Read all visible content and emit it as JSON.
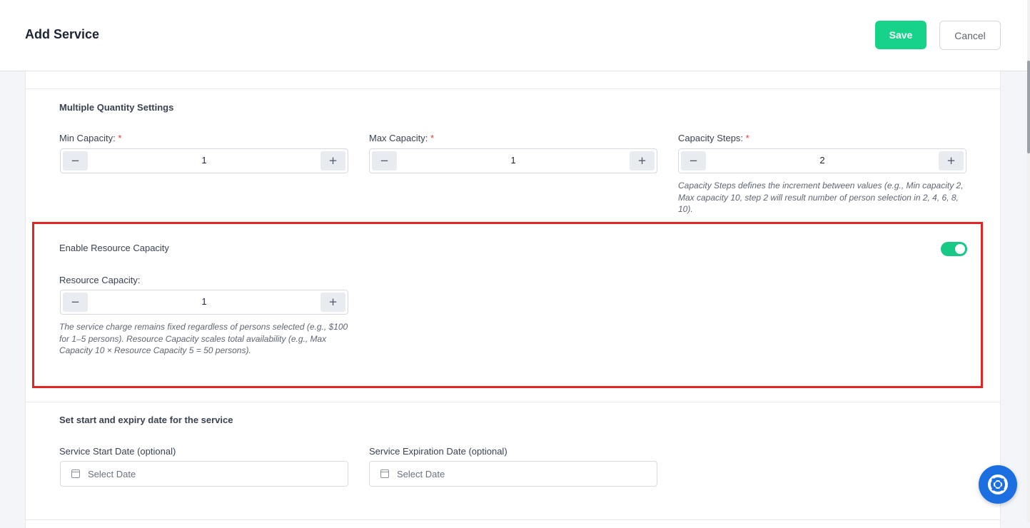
{
  "header": {
    "title": "Add Service",
    "save_label": "Save",
    "cancel_label": "Cancel"
  },
  "quantity": {
    "title": "Multiple Quantity Settings",
    "min": {
      "label": "Min Capacity:",
      "required": "*",
      "value": "1",
      "minus": "−",
      "plus": "+"
    },
    "max": {
      "label": "Max Capacity:",
      "required": "*",
      "value": "1",
      "minus": "−",
      "plus": "+"
    },
    "steps": {
      "label": "Capacity Steps:",
      "required": "*",
      "value": "2",
      "minus": "−",
      "plus": "+"
    },
    "steps_hint": "Capacity Steps defines the increment between values (e.g., Min capacity 2, Max capacity 10, step 2 will result number of person selection in 2, 4, 6, 8, 10)."
  },
  "resource": {
    "title": "Enable Resource Capacity",
    "toggle_on": true,
    "label": "Resource Capacity:",
    "value": "1",
    "minus": "−",
    "plus": "+",
    "hint": "The service charge remains fixed regardless of persons selected (e.g., $100 for 1–5 persons). Resource Capacity scales total availability (e.g., Max Capacity 10 × Resource Capacity 5 = 50 persons)."
  },
  "dates": {
    "title": "Set start and expiry date for the service",
    "start": {
      "label": "Service Start Date (optional)",
      "placeholder": "Select Date"
    },
    "expiry": {
      "label": "Service Expiration Date (optional)",
      "placeholder": "Select Date"
    }
  },
  "colors": {
    "accent": "#17d38a",
    "highlight_border": "#e12525",
    "help_button": "#1b6fe0"
  },
  "icons": {
    "date": "calendar-icon",
    "help": "lifebuoy-icon"
  }
}
